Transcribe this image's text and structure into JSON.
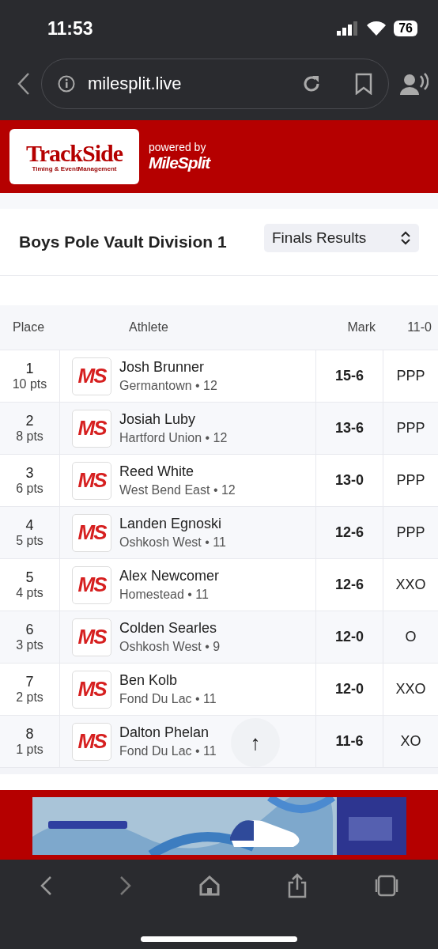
{
  "status_bar": {
    "time": "11:53",
    "battery": "76"
  },
  "address_bar": {
    "url": "milesplit.live"
  },
  "site_header": {
    "logo_title": "TrackSide",
    "logo_subtitle": "Timing & EventManagement",
    "powered_by": "powered by",
    "brand": "MileSplit"
  },
  "event": {
    "title": "Boys Pole Vault Division 1",
    "round_select": "Finals Results"
  },
  "table": {
    "columns": [
      "Place",
      "Athlete",
      "Mark",
      "11-0"
    ],
    "rows": [
      {
        "place": "1",
        "points": "10 pts",
        "logo": "MS",
        "name": "Josh Brunner",
        "team": "Germantown • 12",
        "mark": "15-6",
        "column_4": "PPP"
      },
      {
        "place": "2",
        "points": "8 pts",
        "logo": "MS",
        "name": "Josiah Luby",
        "team": "Hartford Union • 12",
        "mark": "13-6",
        "column_4": "PPP"
      },
      {
        "place": "3",
        "points": "6 pts",
        "logo": "MS",
        "name": "Reed White",
        "team": "West Bend East • 12",
        "mark": "13-0",
        "column_4": "PPP"
      },
      {
        "place": "4",
        "points": "5 pts",
        "logo": "MS",
        "name": "Landen Egnoski",
        "team": "Oshkosh West • 11",
        "mark": "12-6",
        "column_4": "PPP"
      },
      {
        "place": "5",
        "points": "4 pts",
        "logo": "MS",
        "name": "Alex Newcomer",
        "team": "Homestead • 11",
        "mark": "12-6",
        "column_4": "XXO"
      },
      {
        "place": "6",
        "points": "3 pts",
        "logo": "MS",
        "name": "Colden Searles",
        "team": "Oshkosh West • 9",
        "mark": "12-0",
        "column_4": "O"
      },
      {
        "place": "7",
        "points": "2 pts",
        "logo": "MS",
        "name": "Ben Kolb",
        "team": "Fond Du Lac • 11",
        "mark": "12-0",
        "column_4": "XXO"
      },
      {
        "place": "8",
        "points": "1 pts",
        "logo": "MS",
        "name": "Dalton Phelan",
        "team": "Fond Du Lac • 11",
        "mark": "11-6",
        "column_4": "XO"
      }
    ]
  },
  "scroll_top_button": {
    "label": "↑"
  }
}
